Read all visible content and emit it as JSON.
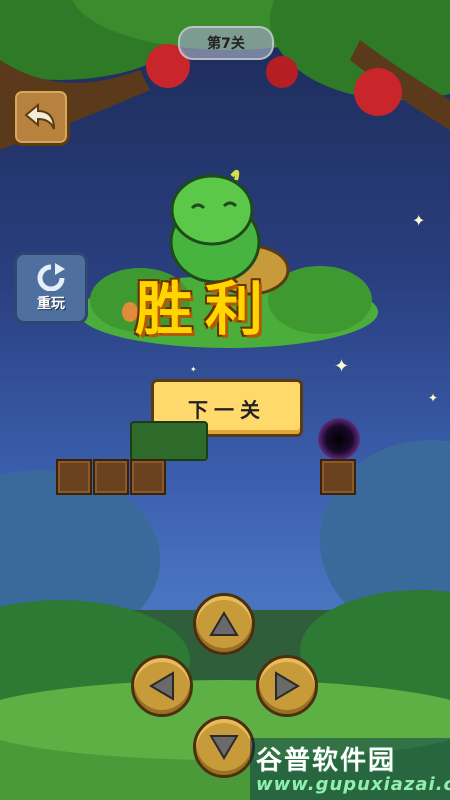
{
  "level": {
    "label": "第7关"
  },
  "controls": {
    "back": {
      "icon": "back-arrow-icon"
    },
    "restart": {
      "icon": "restart-icon",
      "label": "重玩"
    }
  },
  "win": {
    "title": "胜利",
    "next_label": "下一关"
  },
  "dpad": {
    "up": "up-arrow-icon",
    "left": "left-arrow-icon",
    "right": "right-arrow-icon",
    "down": "down-arrow-icon"
  },
  "watermark": {
    "name": "谷普软件园",
    "url": "www.gupuxiazai.com"
  },
  "colors": {
    "sky": "#2a3f80",
    "gold": "#ffd600",
    "button": "#ffd96b",
    "block": "#6b4220"
  }
}
